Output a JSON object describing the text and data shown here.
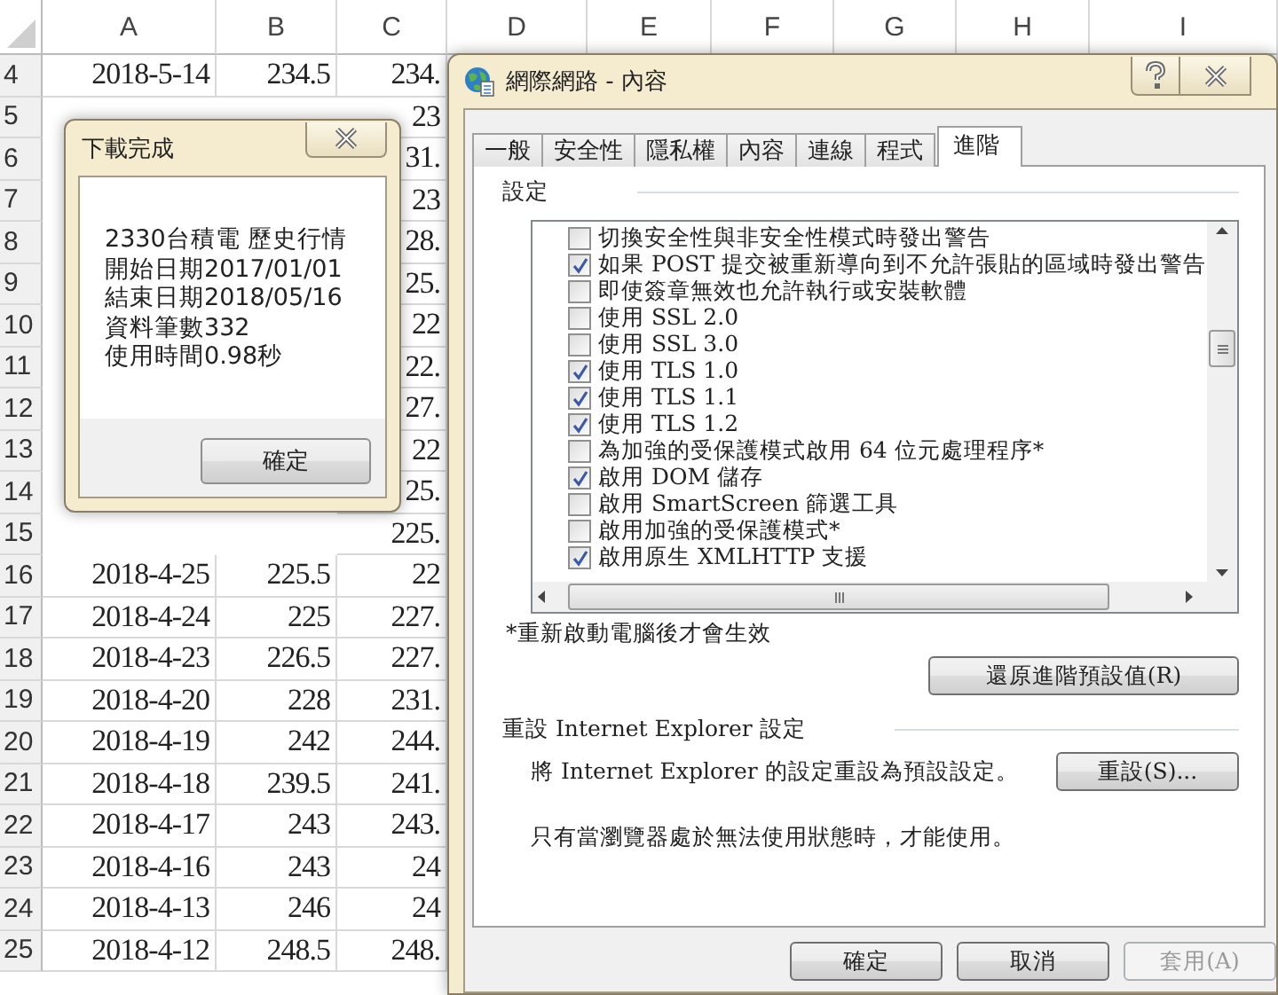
{
  "spreadsheet": {
    "columns": [
      "A",
      "B",
      "C",
      "D",
      "E",
      "F",
      "G",
      "H",
      "I"
    ],
    "rows": [
      {
        "number": "4",
        "a": "2018-5-14",
        "b": "234.5",
        "c": "234."
      },
      {
        "number": "5",
        "c": "23"
      },
      {
        "number": "6",
        "c": "31."
      },
      {
        "number": "7",
        "c": "23"
      },
      {
        "number": "8",
        "c": "28."
      },
      {
        "number": "9",
        "c": "25."
      },
      {
        "number": "10",
        "c": "22"
      },
      {
        "number": "11",
        "c": "22."
      },
      {
        "number": "12",
        "c": "27."
      },
      {
        "number": "13",
        "c": "22"
      },
      {
        "number": "14",
        "c": "25."
      },
      {
        "number": "15",
        "c": "225."
      },
      {
        "number": "16",
        "a": "2018-4-25",
        "b": "225.5",
        "c": "22"
      },
      {
        "number": "17",
        "a": "2018-4-24",
        "b": "225",
        "c": "227."
      },
      {
        "number": "18",
        "a": "2018-4-23",
        "b": "226.5",
        "c": "227."
      },
      {
        "number": "19",
        "a": "2018-4-20",
        "b": "228",
        "c": "231."
      },
      {
        "number": "20",
        "a": "2018-4-19",
        "b": "242",
        "c": "244."
      },
      {
        "number": "21",
        "a": "2018-4-18",
        "b": "239.5",
        "c": "241."
      },
      {
        "number": "22",
        "a": "2018-4-17",
        "b": "243",
        "c": "243."
      },
      {
        "number": "23",
        "a": "2018-4-16",
        "b": "243",
        "c": "24"
      },
      {
        "number": "24",
        "a": "2018-4-13",
        "b": "246",
        "c": "24"
      },
      {
        "number": "25",
        "a": "2018-4-12",
        "b": "248.5",
        "c": "248."
      }
    ]
  },
  "download_dialog": {
    "title": "下載完成",
    "lines": [
      "2330台積電 歷史行情",
      "開始日期2017/01/01",
      "結束日期2018/05/16",
      "資料筆數332",
      "使用時間0.98秒"
    ],
    "button": "確定"
  },
  "ie_window": {
    "title": "網際網路 - 內容",
    "tabs": [
      {
        "label": "一般",
        "selected": false
      },
      {
        "label": "安全性",
        "selected": false
      },
      {
        "label": "隱私權",
        "selected": false
      },
      {
        "label": "內容",
        "selected": false
      },
      {
        "label": "連線",
        "selected": false
      },
      {
        "label": "程式",
        "selected": false
      },
      {
        "label": "進階",
        "selected": true
      }
    ],
    "settings_label": "設定",
    "settings": [
      {
        "label": "切換安全性與非安全性模式時發出警告",
        "checked": false
      },
      {
        "label": "如果 POST 提交被重新導向到不允許張貼的區域時發出警告",
        "checked": true
      },
      {
        "label": "即使簽章無效也允許執行或安裝軟體",
        "checked": false
      },
      {
        "label": "使用 SSL 2.0",
        "checked": false
      },
      {
        "label": "使用 SSL 3.0",
        "checked": false
      },
      {
        "label": "使用 TLS 1.0",
        "checked": true
      },
      {
        "label": "使用 TLS 1.1",
        "checked": true
      },
      {
        "label": "使用 TLS 1.2",
        "checked": true
      },
      {
        "label": "為加強的受保護模式啟用 64 位元處理程序*",
        "checked": false
      },
      {
        "label": "啟用 DOM 儲存",
        "checked": true
      },
      {
        "label": "啟用 SmartScreen 篩選工具",
        "checked": false
      },
      {
        "label": "啟用加強的受保護模式*",
        "checked": false
      },
      {
        "label": "啟用原生 XMLHTTP 支援",
        "checked": true
      }
    ],
    "note": "*重新啟動電腦後才會生效",
    "restore_button": "還原進階預設值(R)",
    "reset_group": "重設 Internet Explorer 設定",
    "reset_text": "將 Internet Explorer 的設定重設為預設設定。",
    "reset_button": "重設(S)...",
    "reset_hint": "只有當瀏覽器處於無法使用狀態時，才能使用。",
    "buttons": [
      {
        "label": "確定",
        "disabled": false
      },
      {
        "label": "取消",
        "disabled": false
      },
      {
        "label": "套用(A)",
        "disabled": true
      }
    ]
  }
}
